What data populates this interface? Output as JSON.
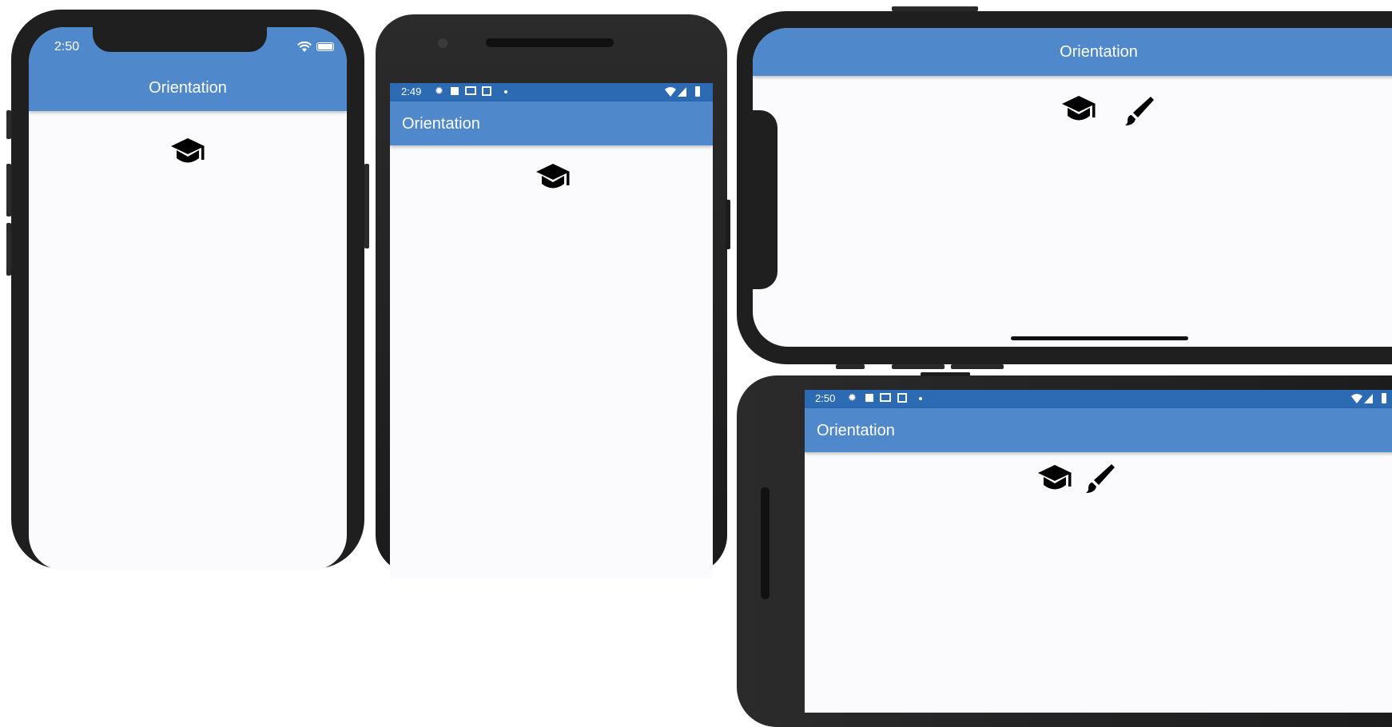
{
  "colors": {
    "appbar": "#5089cb",
    "android_statusbar": "#2c6ab4",
    "device_body": "#1f1f1f",
    "screen_bg": "#fbfbfd"
  },
  "devices": [
    {
      "name": "iphone-portrait",
      "status_time": "2:50",
      "status_icons": [
        "wifi-icon",
        "battery-icon"
      ],
      "app_title": "Orientation",
      "content_icons": [
        "graduation-cap-icon"
      ]
    },
    {
      "name": "android-portrait",
      "status_time": "2:49",
      "status_icons": [
        "settings-icon",
        "a-icon",
        "photo-icon",
        "calendar-icon",
        "dot-icon",
        "wifi-icon",
        "signal-icon",
        "battery-icon"
      ],
      "app_title": "Orientation",
      "content_icons": [
        "graduation-cap-icon"
      ]
    },
    {
      "name": "iphone-landscape",
      "app_title": "Orientation",
      "content_icons": [
        "graduation-cap-icon",
        "paintbrush-icon"
      ]
    },
    {
      "name": "android-landscape",
      "status_time": "2:50",
      "status_icons": [
        "settings-icon",
        "a-icon",
        "photo-icon",
        "calendar-icon",
        "dot-icon",
        "wifi-icon",
        "signal-icon",
        "battery-icon"
      ],
      "app_title": "Orientation",
      "content_icons": [
        "graduation-cap-icon",
        "paintbrush-icon"
      ]
    }
  ]
}
